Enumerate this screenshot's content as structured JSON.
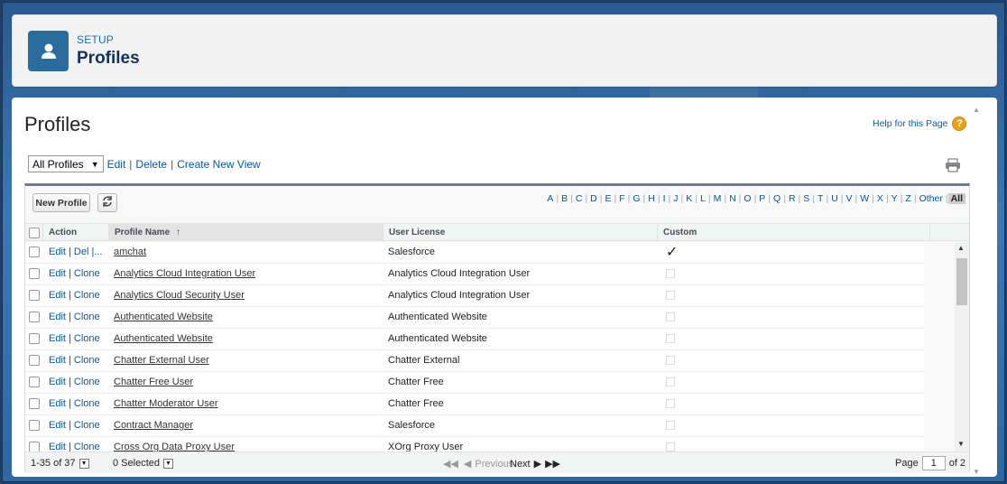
{
  "header": {
    "kicker": "SETUP",
    "title": "Profiles",
    "icon": "user-icon"
  },
  "page": {
    "title": "Profiles",
    "help_link": "Help for this Page",
    "help_icon": "?"
  },
  "view": {
    "selected": "All Profiles",
    "edit": "Edit",
    "delete": "Delete",
    "create": "Create New View"
  },
  "toolbar": {
    "new_button": "New Profile",
    "alphabet": [
      "A",
      "B",
      "C",
      "D",
      "E",
      "F",
      "G",
      "H",
      "I",
      "J",
      "K",
      "L",
      "M",
      "N",
      "O",
      "P",
      "Q",
      "R",
      "S",
      "T",
      "U",
      "V",
      "W",
      "X",
      "Y",
      "Z",
      "Other",
      "All"
    ],
    "active_letter": "All"
  },
  "columns": {
    "action": "Action",
    "profile_name": "Profile Name",
    "sort_indicator": "↑",
    "user_license": "User License",
    "custom": "Custom"
  },
  "rows": [
    {
      "actions": "Edit | Del |...",
      "name": "amchat",
      "license": "Salesforce",
      "custom": true
    },
    {
      "actions": "Edit | Clone",
      "name": "Analytics Cloud Integration User",
      "license": "Analytics Cloud Integration User",
      "custom": false
    },
    {
      "actions": "Edit | Clone",
      "name": "Analytics Cloud Security User",
      "license": "Analytics Cloud Integration User",
      "custom": false
    },
    {
      "actions": "Edit | Clone",
      "name": "Authenticated Website",
      "license": "Authenticated Website",
      "custom": false
    },
    {
      "actions": "Edit | Clone",
      "name": "Authenticated Website",
      "license": "Authenticated Website",
      "custom": false
    },
    {
      "actions": "Edit | Clone",
      "name": "Chatter External User",
      "license": "Chatter External",
      "custom": false
    },
    {
      "actions": "Edit | Clone",
      "name": "Chatter Free User",
      "license": "Chatter Free",
      "custom": false
    },
    {
      "actions": "Edit | Clone",
      "name": "Chatter Moderator User",
      "license": "Chatter Free",
      "custom": false
    },
    {
      "actions": "Edit | Clone",
      "name": "Contract Manager",
      "license": "Salesforce",
      "custom": false
    },
    {
      "actions": "Edit | Clone",
      "name": "Cross Org Data Proxy User",
      "license": "XOrg Proxy User",
      "custom": false
    }
  ],
  "footer": {
    "range": "1-35 of 37",
    "selected": "0 Selected",
    "previous": "Previous",
    "next": "Next",
    "page_label": "Page",
    "page_value": "1",
    "of_pages": "of 2"
  }
}
